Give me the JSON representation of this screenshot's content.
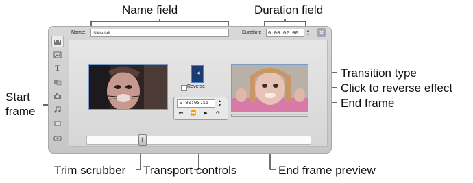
{
  "callouts": {
    "name_field": "Name field",
    "duration_field": "Duration field",
    "transition_type": "Transition type",
    "reverse_effect": "Click to reverse effect",
    "end_frame": "End frame",
    "start_frame_line1": "Start",
    "start_frame_line2": "frame",
    "trim_scrubber": "Trim scrubber",
    "transport_controls": "Transport controls",
    "end_frame_preview": "End frame preview"
  },
  "editor": {
    "name_label": "Name:",
    "name_value": "Slide left",
    "duration_label": "Duration:",
    "duration_value": "0:00:02.00",
    "reverse_label": "Reverse",
    "timecode": "0:00:00.15",
    "close_glyph": "×"
  },
  "sidebar_icons": [
    "video-clip-icon",
    "image-icon",
    "title-icon",
    "transition-icon",
    "camera-icon",
    "audio-icon",
    "effects-icon",
    "settings-icon"
  ],
  "transport_icons": [
    "skip-back-icon",
    "step-back-icon",
    "play-icon",
    "loop-icon"
  ],
  "colors": {
    "frame_border": "#7a9cc8",
    "transition_fill": "#1a3b6f",
    "transition_border": "#4f83d1"
  }
}
